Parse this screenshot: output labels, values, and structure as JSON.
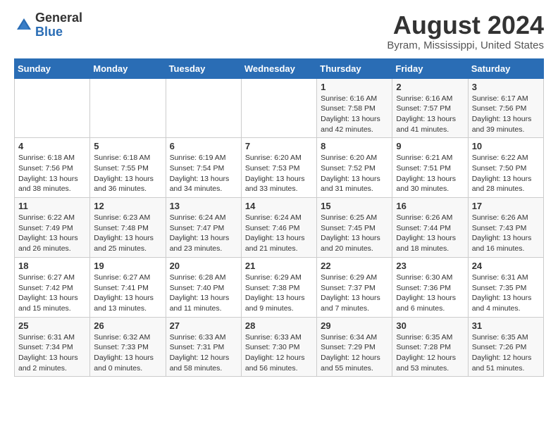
{
  "logo": {
    "general": "General",
    "blue": "Blue"
  },
  "header": {
    "title": "August 2024",
    "subtitle": "Byram, Mississippi, United States"
  },
  "weekdays": [
    "Sunday",
    "Monday",
    "Tuesday",
    "Wednesday",
    "Thursday",
    "Friday",
    "Saturday"
  ],
  "weeks": [
    [
      {
        "day": "",
        "info": ""
      },
      {
        "day": "",
        "info": ""
      },
      {
        "day": "",
        "info": ""
      },
      {
        "day": "",
        "info": ""
      },
      {
        "day": "1",
        "info": "Sunrise: 6:16 AM\nSunset: 7:58 PM\nDaylight: 13 hours\nand 42 minutes."
      },
      {
        "day": "2",
        "info": "Sunrise: 6:16 AM\nSunset: 7:57 PM\nDaylight: 13 hours\nand 41 minutes."
      },
      {
        "day": "3",
        "info": "Sunrise: 6:17 AM\nSunset: 7:56 PM\nDaylight: 13 hours\nand 39 minutes."
      }
    ],
    [
      {
        "day": "4",
        "info": "Sunrise: 6:18 AM\nSunset: 7:56 PM\nDaylight: 13 hours\nand 38 minutes."
      },
      {
        "day": "5",
        "info": "Sunrise: 6:18 AM\nSunset: 7:55 PM\nDaylight: 13 hours\nand 36 minutes."
      },
      {
        "day": "6",
        "info": "Sunrise: 6:19 AM\nSunset: 7:54 PM\nDaylight: 13 hours\nand 34 minutes."
      },
      {
        "day": "7",
        "info": "Sunrise: 6:20 AM\nSunset: 7:53 PM\nDaylight: 13 hours\nand 33 minutes."
      },
      {
        "day": "8",
        "info": "Sunrise: 6:20 AM\nSunset: 7:52 PM\nDaylight: 13 hours\nand 31 minutes."
      },
      {
        "day": "9",
        "info": "Sunrise: 6:21 AM\nSunset: 7:51 PM\nDaylight: 13 hours\nand 30 minutes."
      },
      {
        "day": "10",
        "info": "Sunrise: 6:22 AM\nSunset: 7:50 PM\nDaylight: 13 hours\nand 28 minutes."
      }
    ],
    [
      {
        "day": "11",
        "info": "Sunrise: 6:22 AM\nSunset: 7:49 PM\nDaylight: 13 hours\nand 26 minutes."
      },
      {
        "day": "12",
        "info": "Sunrise: 6:23 AM\nSunset: 7:48 PM\nDaylight: 13 hours\nand 25 minutes."
      },
      {
        "day": "13",
        "info": "Sunrise: 6:24 AM\nSunset: 7:47 PM\nDaylight: 13 hours\nand 23 minutes."
      },
      {
        "day": "14",
        "info": "Sunrise: 6:24 AM\nSunset: 7:46 PM\nDaylight: 13 hours\nand 21 minutes."
      },
      {
        "day": "15",
        "info": "Sunrise: 6:25 AM\nSunset: 7:45 PM\nDaylight: 13 hours\nand 20 minutes."
      },
      {
        "day": "16",
        "info": "Sunrise: 6:26 AM\nSunset: 7:44 PM\nDaylight: 13 hours\nand 18 minutes."
      },
      {
        "day": "17",
        "info": "Sunrise: 6:26 AM\nSunset: 7:43 PM\nDaylight: 13 hours\nand 16 minutes."
      }
    ],
    [
      {
        "day": "18",
        "info": "Sunrise: 6:27 AM\nSunset: 7:42 PM\nDaylight: 13 hours\nand 15 minutes."
      },
      {
        "day": "19",
        "info": "Sunrise: 6:27 AM\nSunset: 7:41 PM\nDaylight: 13 hours\nand 13 minutes."
      },
      {
        "day": "20",
        "info": "Sunrise: 6:28 AM\nSunset: 7:40 PM\nDaylight: 13 hours\nand 11 minutes."
      },
      {
        "day": "21",
        "info": "Sunrise: 6:29 AM\nSunset: 7:38 PM\nDaylight: 13 hours\nand 9 minutes."
      },
      {
        "day": "22",
        "info": "Sunrise: 6:29 AM\nSunset: 7:37 PM\nDaylight: 13 hours\nand 7 minutes."
      },
      {
        "day": "23",
        "info": "Sunrise: 6:30 AM\nSunset: 7:36 PM\nDaylight: 13 hours\nand 6 minutes."
      },
      {
        "day": "24",
        "info": "Sunrise: 6:31 AM\nSunset: 7:35 PM\nDaylight: 13 hours\nand 4 minutes."
      }
    ],
    [
      {
        "day": "25",
        "info": "Sunrise: 6:31 AM\nSunset: 7:34 PM\nDaylight: 13 hours\nand 2 minutes."
      },
      {
        "day": "26",
        "info": "Sunrise: 6:32 AM\nSunset: 7:33 PM\nDaylight: 13 hours\nand 0 minutes."
      },
      {
        "day": "27",
        "info": "Sunrise: 6:33 AM\nSunset: 7:31 PM\nDaylight: 12 hours\nand 58 minutes."
      },
      {
        "day": "28",
        "info": "Sunrise: 6:33 AM\nSunset: 7:30 PM\nDaylight: 12 hours\nand 56 minutes."
      },
      {
        "day": "29",
        "info": "Sunrise: 6:34 AM\nSunset: 7:29 PM\nDaylight: 12 hours\nand 55 minutes."
      },
      {
        "day": "30",
        "info": "Sunrise: 6:35 AM\nSunset: 7:28 PM\nDaylight: 12 hours\nand 53 minutes."
      },
      {
        "day": "31",
        "info": "Sunrise: 6:35 AM\nSunset: 7:26 PM\nDaylight: 12 hours\nand 51 minutes."
      }
    ]
  ]
}
